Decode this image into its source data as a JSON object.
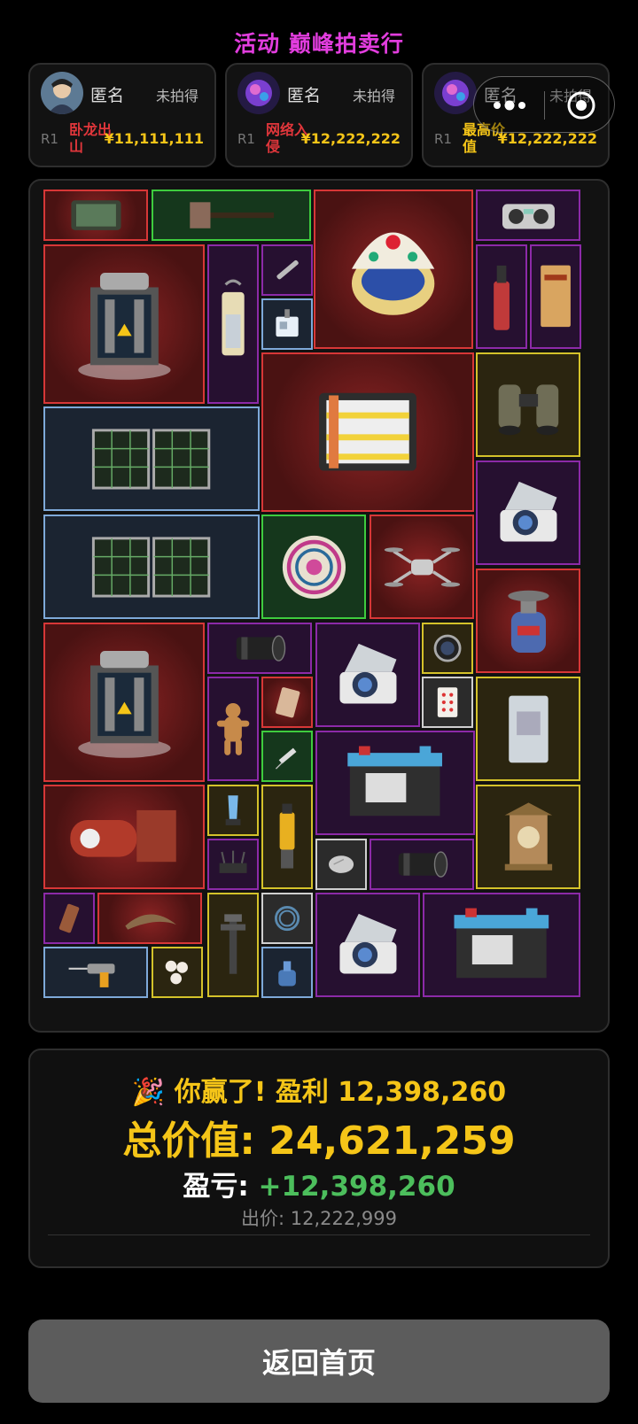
{
  "header": {
    "title": "活动 巅峰拍卖行"
  },
  "bidders": [
    {
      "name": "匿名",
      "status": "未拍得",
      "round": "R1",
      "tag": "卧龙出山",
      "tag_color": "#e0363b",
      "price": "¥11,111,111",
      "avatar_icon": "warrior-avatar"
    },
    {
      "name": "匿名",
      "status": "未拍得",
      "round": "R1",
      "tag": "网络入侵",
      "tag_color": "#e0363b",
      "price": "¥12,222,222",
      "avatar_icon": "purple-spirit-avatar"
    },
    {
      "name": "匿名",
      "status": "未拍得",
      "round": "R1",
      "tag": "最高价值",
      "tag_color": "#f5c518",
      "price": "¥12,222,222",
      "avatar_icon": "purple-spirit-avatar"
    }
  ],
  "capsule": {
    "more_icon": "more-dots-icon",
    "close_icon": "target-circle-icon"
  },
  "items": [
    {
      "id": "tactical-tablet",
      "quality": "red",
      "icon": "tablet-icon"
    },
    {
      "id": "sledgehammer",
      "quality": "green",
      "icon": "hammer-icon"
    },
    {
      "id": "jeweled-egg",
      "quality": "red",
      "icon": "egg-icon"
    },
    {
      "id": "boombox-radio",
      "quality": "purple",
      "icon": "radio-icon"
    },
    {
      "id": "reactor-core-1",
      "quality": "red",
      "icon": "reactor-icon"
    },
    {
      "id": "lantern",
      "quality": "purple",
      "icon": "lantern-icon"
    },
    {
      "id": "airbrush-pen",
      "quality": "purple",
      "icon": "pen-icon"
    },
    {
      "id": "id-badge",
      "quality": "blue",
      "icon": "badge-icon"
    },
    {
      "id": "blow-torch",
      "quality": "purple",
      "icon": "torch-icon"
    },
    {
      "id": "black-tide-manual",
      "quality": "purple",
      "icon": "book-icon"
    },
    {
      "id": "battery-pack",
      "quality": "red",
      "icon": "battery-pack-icon"
    },
    {
      "id": "binoculars",
      "quality": "gold",
      "icon": "binoculars-icon"
    },
    {
      "id": "solar-panel-1",
      "quality": "blue",
      "icon": "solar-panel-icon"
    },
    {
      "id": "centrifuge-1",
      "quality": "purple",
      "icon": "centrifuge-icon"
    },
    {
      "id": "solar-panel-2",
      "quality": "blue",
      "icon": "solar-panel-icon"
    },
    {
      "id": "ornate-plate",
      "quality": "green",
      "icon": "plate-icon"
    },
    {
      "id": "drone",
      "quality": "red",
      "icon": "drone-icon"
    },
    {
      "id": "gas-canister",
      "quality": "red",
      "icon": "gas-canister-icon"
    },
    {
      "id": "reactor-core-2",
      "quality": "red",
      "icon": "reactor-icon"
    },
    {
      "id": "camera-lens-1",
      "quality": "purple",
      "icon": "lens-icon"
    },
    {
      "id": "centrifuge-2",
      "quality": "purple",
      "icon": "centrifuge-icon"
    },
    {
      "id": "lens-filter",
      "quality": "gold",
      "icon": "filter-icon"
    },
    {
      "id": "playing-card",
      "quality": "white",
      "icon": "card-icon"
    },
    {
      "id": "gingerbread-man",
      "quality": "purple",
      "icon": "gingerbread-icon"
    },
    {
      "id": "trading-card",
      "quality": "red",
      "icon": "trading-card-icon"
    },
    {
      "id": "id-card-pouch",
      "quality": "gold",
      "icon": "id-card-icon"
    },
    {
      "id": "syringe",
      "quality": "green",
      "icon": "syringe-icon"
    },
    {
      "id": "car-battery-1",
      "quality": "purple",
      "icon": "car-battery-icon"
    },
    {
      "id": "rocket-engine",
      "quality": "red",
      "icon": "engine-icon"
    },
    {
      "id": "crystal-trophy",
      "quality": "gold",
      "icon": "trophy-icon"
    },
    {
      "id": "wifi-router",
      "quality": "purple",
      "icon": "router-icon"
    },
    {
      "id": "hydraulic-jack",
      "quality": "gold",
      "icon": "jack-icon"
    },
    {
      "id": "computer-mouse",
      "quality": "white",
      "icon": "mouse-icon"
    },
    {
      "id": "camera-lens-2",
      "quality": "purple",
      "icon": "lens-icon"
    },
    {
      "id": "clock-shrine",
      "quality": "gold",
      "icon": "clock-icon"
    },
    {
      "id": "snack-bar",
      "quality": "purple",
      "icon": "snack-icon"
    },
    {
      "id": "fossil-claw",
      "quality": "red",
      "icon": "claw-icon"
    },
    {
      "id": "faucet-valve",
      "quality": "gold",
      "icon": "faucet-icon"
    },
    {
      "id": "coiled-cable",
      "quality": "white",
      "icon": "cable-icon"
    },
    {
      "id": "centrifuge-3",
      "quality": "purple",
      "icon": "centrifuge-icon"
    },
    {
      "id": "car-battery-2",
      "quality": "purple",
      "icon": "car-battery-icon"
    },
    {
      "id": "power-drill",
      "quality": "blue",
      "icon": "drill-icon"
    },
    {
      "id": "pearls",
      "quality": "gold",
      "icon": "pearl-icon"
    },
    {
      "id": "ink-bottle",
      "quality": "blue",
      "icon": "bottle-icon"
    }
  ],
  "result": {
    "headline": "🎉 你赢了! 盈利 12,398,260",
    "total_value": "总价值: 24,621,259",
    "pl_label": "盈亏: ",
    "pl_value": "+12,398,260",
    "bid": "出价: 12,222,999"
  },
  "footer": {
    "home_button": "返回首页"
  },
  "colors": {
    "title": "#e23dde",
    "gold_text": "#f5c518",
    "profit_green": "#4cbe5c",
    "q_red": "#d73737",
    "q_purple": "#8c2aa8",
    "q_gold": "#d4c22a",
    "q_blue": "#7ea9d9",
    "q_green": "#3ecc3e",
    "q_white": "#cfcfcf"
  }
}
